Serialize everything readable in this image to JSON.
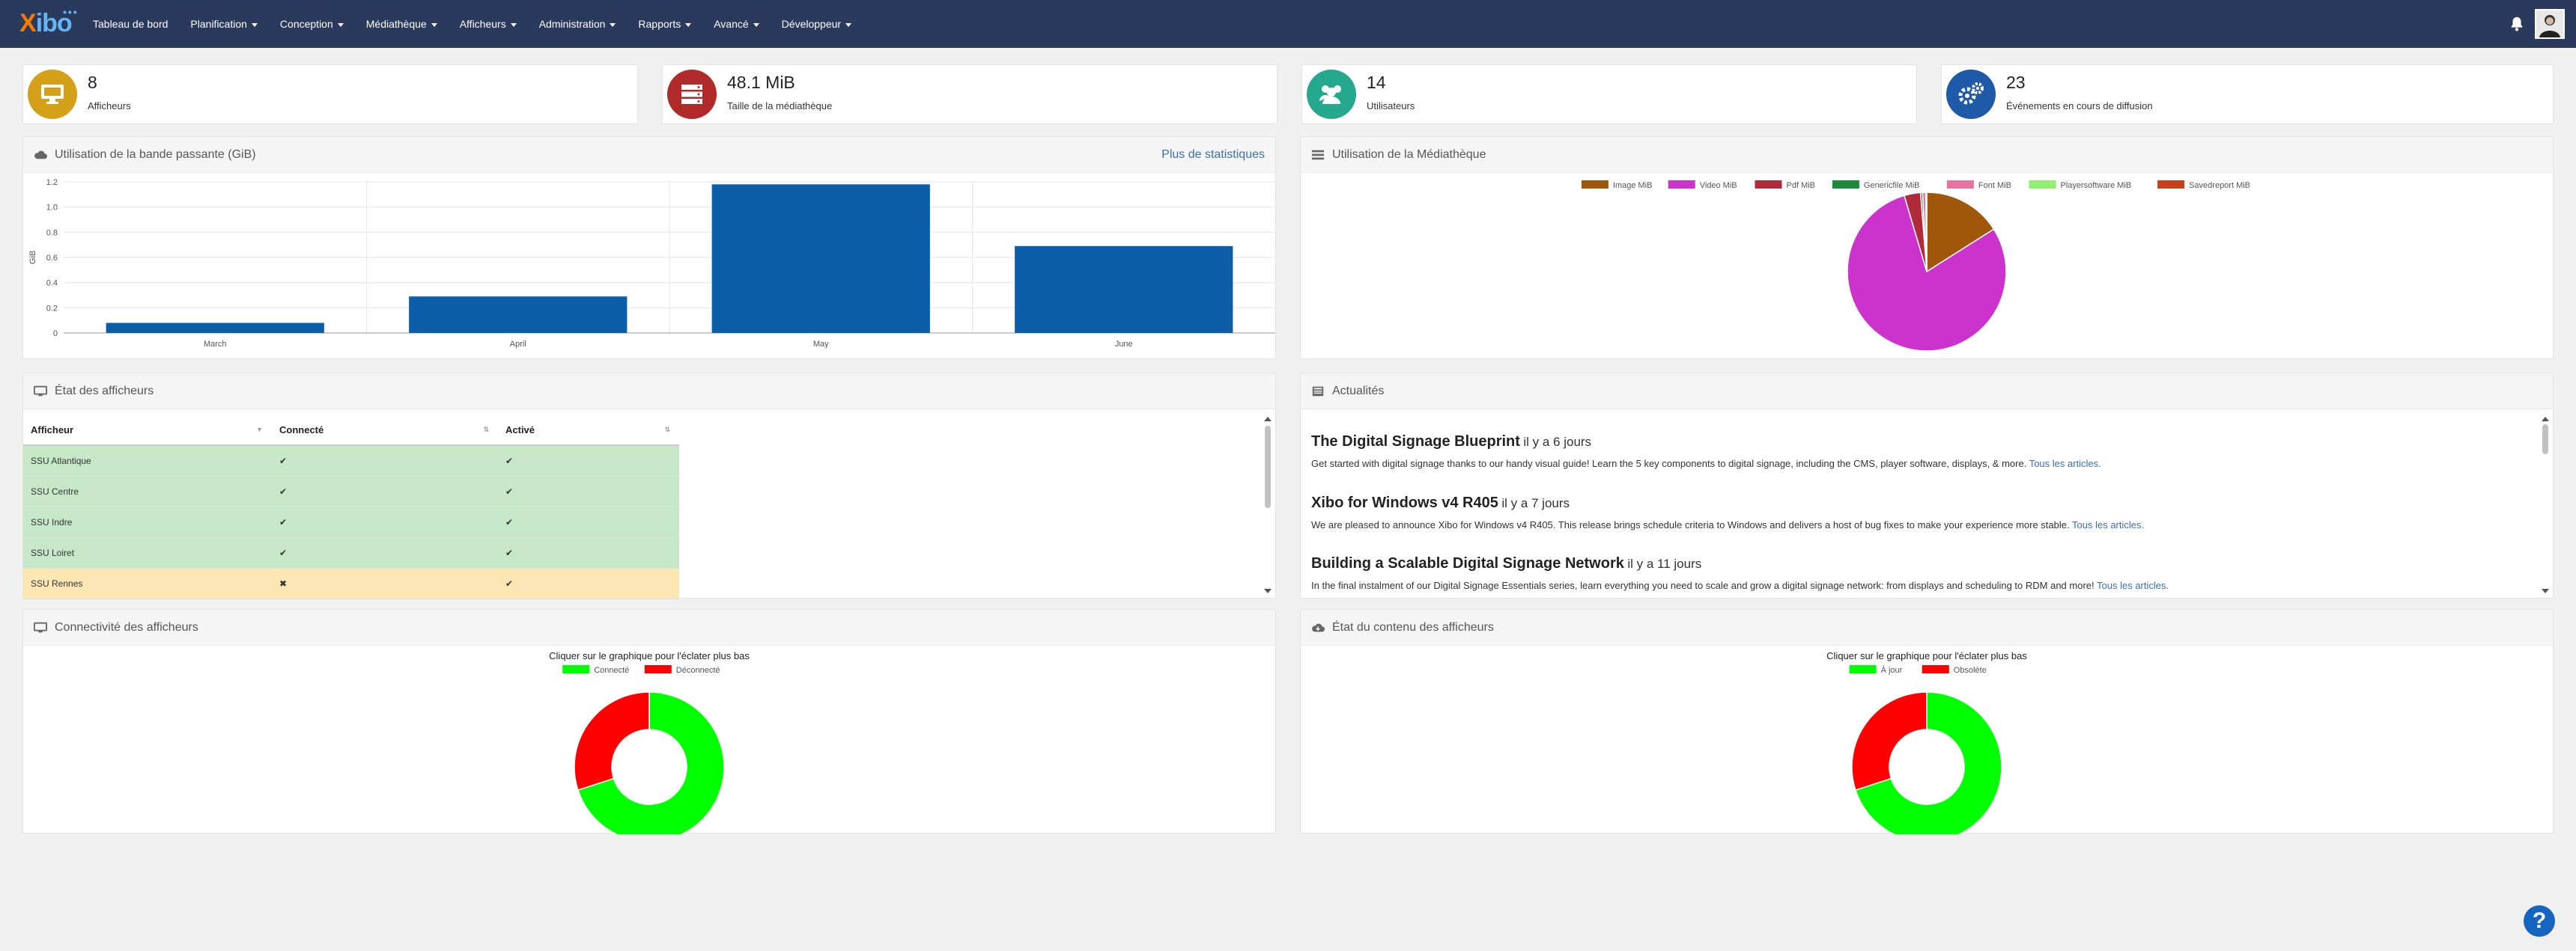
{
  "nav": {
    "logo_x": "X",
    "logo_rest": "ibo",
    "items": [
      {
        "label": "Tableau de bord",
        "dropdown": false
      },
      {
        "label": "Planification",
        "dropdown": true
      },
      {
        "label": "Conception",
        "dropdown": true
      },
      {
        "label": "Médiathèque",
        "dropdown": true
      },
      {
        "label": "Afficheurs",
        "dropdown": true
      },
      {
        "label": "Administration",
        "dropdown": true
      },
      {
        "label": "Rapports",
        "dropdown": true
      },
      {
        "label": "Avancé",
        "dropdown": true
      },
      {
        "label": "Développeur",
        "dropdown": true
      }
    ]
  },
  "stats": [
    {
      "value": "8",
      "label": "Afficheurs",
      "color": "#d4a017",
      "icon": "monitor-icon"
    },
    {
      "value": "48.1 MiB",
      "label": "Taille de la médiathèque",
      "color": "#b02a2a",
      "icon": "server-icon"
    },
    {
      "value": "14",
      "label": "Utilisateurs",
      "color": "#26a88e",
      "icon": "users-icon"
    },
    {
      "value": "23",
      "label": "Événements en cours de diffusion",
      "color": "#1e5aa8",
      "icon": "gears-icon"
    }
  ],
  "bandwidth": {
    "title": "Utilisation de la bande passante (GiB)",
    "link": "Plus de statistiques",
    "chart_data": {
      "type": "bar",
      "categories": [
        "March",
        "April",
        "May",
        "June"
      ],
      "values": [
        0.08,
        0.29,
        1.18,
        0.69
      ],
      "ylabel": "GiB",
      "ylim": [
        0,
        1.2
      ],
      "yticks": [
        "0",
        "0.2",
        "0.4",
        "0.6",
        "0.8",
        "1.0",
        "1.2"
      ],
      "color": "#0d5ea8",
      "grid": true
    }
  },
  "library": {
    "title": "Utilisation de la Médiathèque",
    "chart_data": {
      "type": "pie",
      "legend_position": "top",
      "series": [
        {
          "name": "Image MiB",
          "value": 7.7,
          "color": "#a0570a"
        },
        {
          "name": "Video MiB",
          "value": 38.2,
          "color": "#cc33cc"
        },
        {
          "name": "Pdf MiB",
          "value": 1.6,
          "color": "#b02a3a"
        },
        {
          "name": "Genericfile MiB",
          "value": 0.2,
          "color": "#1b8a3a"
        },
        {
          "name": "Font MiB",
          "value": 0.3,
          "color": "#e6739f"
        },
        {
          "name": "Playersoftware MiB",
          "value": 0.05,
          "color": "#90ee70"
        },
        {
          "name": "Savedreport MiB",
          "value": 0.05,
          "color": "#c8401a"
        }
      ]
    }
  },
  "displays": {
    "title": "État des afficheurs",
    "columns": [
      "Afficheur",
      "Connecté",
      "Activé"
    ],
    "rows": [
      {
        "name": "SSU Atlantique",
        "connected": "✔",
        "enabled": "✔",
        "status": "ok"
      },
      {
        "name": "SSU Centre",
        "connected": "✔",
        "enabled": "✔",
        "status": "ok"
      },
      {
        "name": "SSU Indre",
        "connected": "✔",
        "enabled": "✔",
        "status": "ok"
      },
      {
        "name": "SSU Loiret",
        "connected": "✔",
        "enabled": "✔",
        "status": "ok"
      },
      {
        "name": "SSU Rennes",
        "connected": "✖",
        "enabled": "✔",
        "status": "warn"
      }
    ]
  },
  "news": {
    "title": "Actualités",
    "link_label": "Tous les articles.",
    "items": [
      {
        "title": "The Digital Signage Blueprint",
        "age": "il y a 6 jours",
        "body": "Get started with digital signage thanks to our handy visual guide! Learn the 5 key components to digital signage, including the CMS, player software, displays, & more."
      },
      {
        "title": "Xibo for Windows v4 R405",
        "age": "il y a 7 jours",
        "body": "We are pleased to announce Xibo for Windows v4 R405. This release brings schedule criteria to Windows and delivers a host of bug fixes to make your experience more stable."
      },
      {
        "title": "Building a Scalable Digital Signage Network",
        "age": "il y a 11 jours",
        "body": "In the final instalment of our Digital Signage Essentials series, learn everything you need to scale and grow a digital signage network: from displays and scheduling to RDM and more!"
      }
    ]
  },
  "connectivity": {
    "title": "Connectivité des afficheurs",
    "caption": "Cliquer sur le graphique pour l'éclater plus bas",
    "chart_data": {
      "type": "pie",
      "donut": true,
      "legend_position": "top",
      "series": [
        {
          "name": "Connecté",
          "value": 7,
          "color": "#00ff00"
        },
        {
          "name": "Déconnecté",
          "value": 3,
          "color": "#ff0000"
        }
      ]
    }
  },
  "content_status": {
    "title": "État du contenu des afficheurs",
    "caption": "Cliquer sur le graphique pour l'éclater plus bas",
    "chart_data": {
      "type": "pie",
      "donut": true,
      "legend_position": "top",
      "series": [
        {
          "name": "À jour",
          "value": 7,
          "color": "#00ff00"
        },
        {
          "name": "Obsolète",
          "value": 3,
          "color": "#ff0000"
        }
      ]
    }
  },
  "help_label": "?"
}
